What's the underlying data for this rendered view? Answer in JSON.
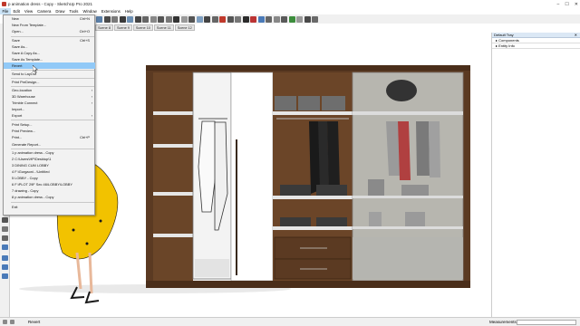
{
  "window": {
    "title": "p animation dress - Copy - SketchUp Pro 2021",
    "controls": [
      "–",
      "☐",
      "✕"
    ]
  },
  "menubar": [
    "File",
    "Edit",
    "View",
    "Camera",
    "Draw",
    "Tools",
    "Window",
    "Extensions",
    "Help"
  ],
  "scenes": [
    "Scene 8",
    "Scene 9",
    "Scene 10",
    "Scene 11",
    "Scene 12"
  ],
  "file_menu": [
    {
      "label": "New",
      "shortcut": "Ctrl+N"
    },
    {
      "label": "New From Template..."
    },
    {
      "label": "Open...",
      "shortcut": "Ctrl+O"
    },
    {
      "label": "Save",
      "shortcut": "Ctrl+S"
    },
    {
      "label": "Save As..."
    },
    {
      "label": "Save A Copy As..."
    },
    {
      "label": "Save As Template..."
    },
    {
      "label": "Revert",
      "highlighted": true
    },
    {
      "label": "Send to LayOut"
    },
    {
      "label": "Print PreDesign..."
    },
    {
      "label": "Geo-location",
      "submenu": true
    },
    {
      "label": "3D Warehouse",
      "submenu": true
    },
    {
      "label": "Trimble Connect",
      "submenu": true
    },
    {
      "label": "Import..."
    },
    {
      "label": "Export",
      "submenu": true
    },
    {
      "label": "Print Setup..."
    },
    {
      "label": "Print Preview..."
    },
    {
      "label": "Print...",
      "shortcut": "Ctrl+P"
    },
    {
      "label": "Generate Report..."
    },
    {
      "label": "1 p animation dress - Copy"
    },
    {
      "label": "2 C:\\Users\\HP\\Desktop\\1"
    },
    {
      "label": "3 DINING CUM LOBBY"
    },
    {
      "label": "4 F:\\Gurgaon\\...\\Untitled"
    },
    {
      "label": "5 LOBBY - Copy"
    },
    {
      "label": "6 F:\\PLOT 29F Sec 46\\LOBBY\\LOBBY"
    },
    {
      "label": "7 drawing - Copy"
    },
    {
      "label": "8 p animation dress - Copy"
    },
    {
      "label": "Exit"
    }
  ],
  "tray": {
    "title": "Default Tray",
    "close": "✕",
    "items": [
      "▸ Components",
      "▸ Entity Info"
    ]
  },
  "statusbar": {
    "text": "Revert",
    "measurements_label": "Measurements"
  },
  "colors": {
    "wardrobe_wood": "#5b3a22",
    "menu_highlight": "#91c9f7",
    "dress_yellow": "#f2c200"
  }
}
